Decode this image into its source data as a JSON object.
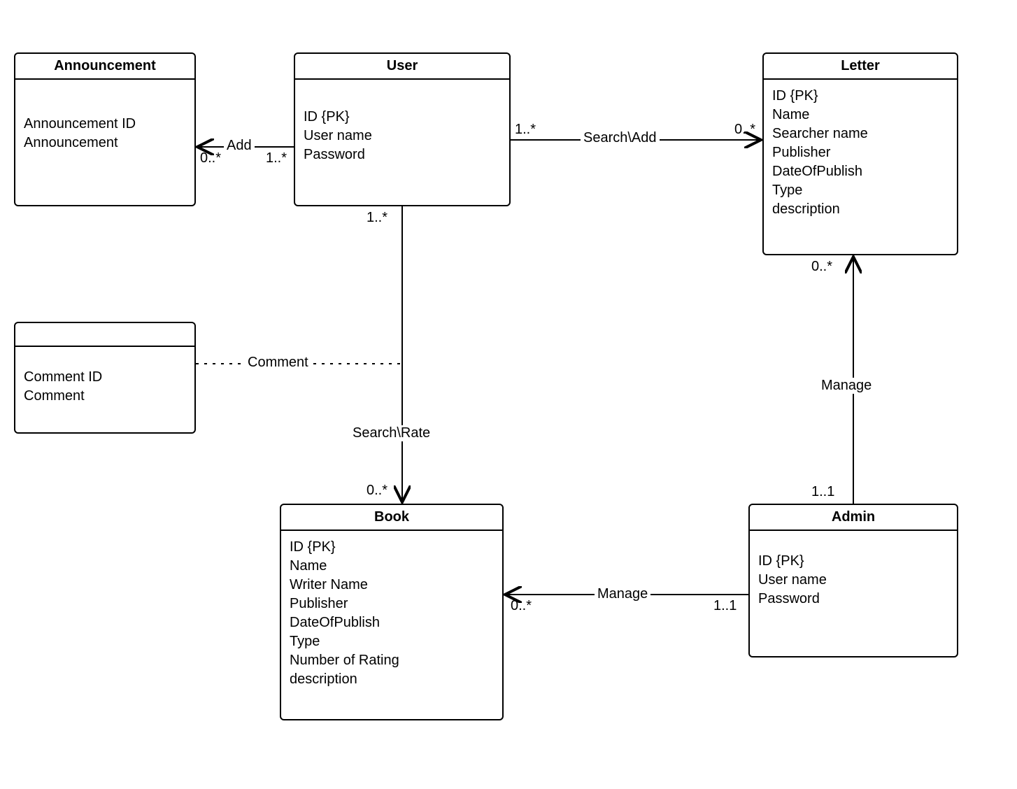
{
  "entities": {
    "announcement": {
      "title": "Announcement",
      "attrs": [
        "Announcement ID",
        "Announcement"
      ]
    },
    "user": {
      "title": "User",
      "attrs": [
        "ID {PK}",
        "User name",
        "Password"
      ]
    },
    "letter": {
      "title": "Letter",
      "attrs": [
        "ID {PK}",
        "Name",
        "Searcher name",
        "Publisher",
        "DateOfPublish",
        "Type",
        "description"
      ]
    },
    "comment": {
      "title": "",
      "attrs": [
        "Comment ID",
        "Comment"
      ]
    },
    "book": {
      "title": "Book",
      "attrs": [
        "ID {PK}",
        "Name",
        "Writer Name",
        "Publisher",
        "DateOfPublish",
        "Type",
        "Number of Rating",
        "description"
      ]
    },
    "admin": {
      "title": "Admin",
      "attrs": [
        "ID {PK}",
        "User name",
        "Password"
      ]
    }
  },
  "associations": {
    "user_announcement": {
      "label": "Add",
      "mult_source": "1..*",
      "mult_target": "0..*"
    },
    "user_letter": {
      "label": "Search\\Add",
      "mult_source": "1..*",
      "mult_target": "0..*"
    },
    "user_book": {
      "label": "Search\\Rate",
      "mult_source": "1..*",
      "mult_target": "0..*"
    },
    "user_book_comment": {
      "label": "Comment"
    },
    "admin_book": {
      "label": "Manage",
      "mult_source": "1..1",
      "mult_target": "0..*"
    },
    "admin_letter": {
      "label": "Manage",
      "mult_source": "1..1",
      "mult_target": "0..*"
    }
  }
}
